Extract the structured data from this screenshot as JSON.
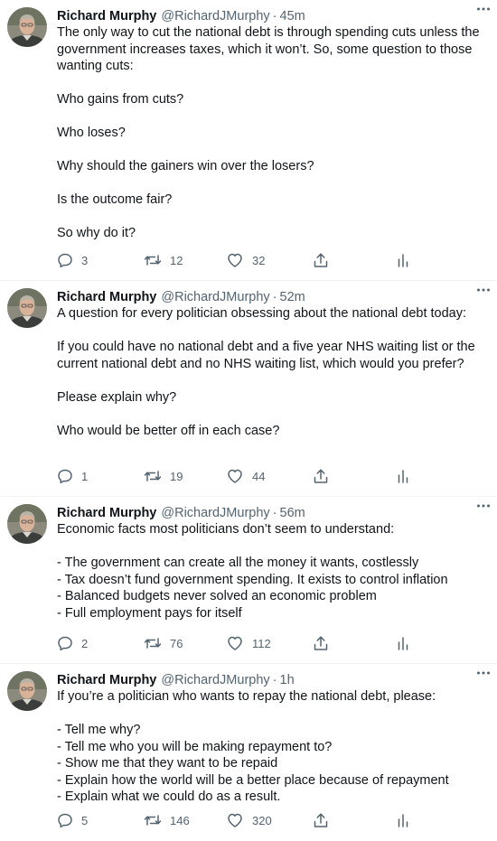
{
  "tweets": [
    {
      "author": "Richard Murphy",
      "handle": "@RichardJMurphy",
      "separator": "·",
      "time": "45m",
      "paragraphs": [
        "The only way to cut the national debt is through spending cuts unless the government increases taxes, which it won’t. So, some question to those wanting cuts:",
        "Who gains from cuts?",
        "Who loses?",
        "Why should the gainers win over the losers?",
        "Is the outcome fair?",
        "So why do it?"
      ],
      "replies": "3",
      "retweets": "12",
      "likes": "32"
    },
    {
      "author": "Richard Murphy",
      "handle": "@RichardJMurphy",
      "separator": "·",
      "time": "52m",
      "paragraphs": [
        "A question for every politician obsessing about the national debt today:",
        "If you could have no national debt and a five year NHS waiting list or the current national debt and no NHS waiting list, which would you prefer?",
        "Please explain why?",
        "Who would be better off in each case?"
      ],
      "replies": "1",
      "retweets": "19",
      "likes": "44"
    },
    {
      "author": "Richard Murphy",
      "handle": "@RichardJMurphy",
      "separator": "·",
      "time": "56m",
      "paragraphs": [
        "Economic facts most politicians don’t seem to understand:",
        "- The government can create all the money it wants, costlessly\n- Tax doesn’t fund government spending. It exists to control inflation\n- Balanced budgets never solved an economic problem\n- Full employment pays for itself"
      ],
      "replies": "2",
      "retweets": "76",
      "likes": "112"
    },
    {
      "author": "Richard Murphy",
      "handle": "@RichardJMurphy",
      "separator": "·",
      "time": "1h",
      "paragraphs": [
        "If you’re a politician who wants to repay the national debt, please:",
        "- Tell me why?\n- Tell me who you will be making repayment to?\n- Show me that they want to be repaid\n- Explain how the world will be a better place because of repayment\n- Explain what we could do as a result."
      ],
      "replies": "5",
      "retweets": "146",
      "likes": "320"
    }
  ],
  "icons": {
    "reply": "reply-icon",
    "retweet": "retweet-icon",
    "like": "like-icon",
    "share": "share-icon",
    "analytics": "analytics-icon",
    "more": "more-icon",
    "avatar": "avatar"
  },
  "colors": {
    "text": "#0f1419",
    "muted": "#536471",
    "divider": "#eff3f4"
  }
}
